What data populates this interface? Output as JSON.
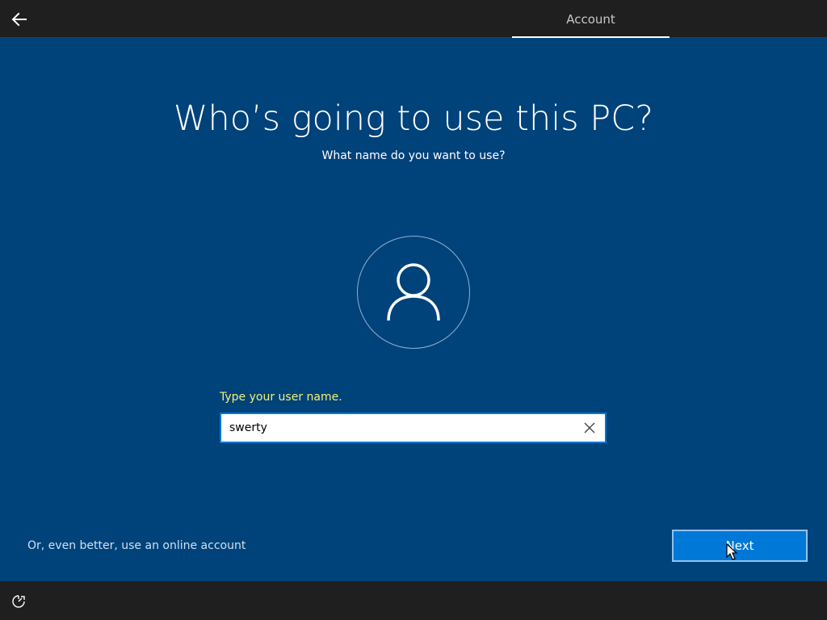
{
  "header": {
    "back_icon": "back-arrow-icon",
    "tab_label": "Account"
  },
  "main": {
    "title": "Who’s going to use this PC?",
    "subtitle": "What name do you want to use?",
    "avatar_icon": "person-icon"
  },
  "username": {
    "label": "Type your user name.",
    "value": "swerty",
    "clear_icon": "clear-x-icon"
  },
  "footer": {
    "online_account_link": "Or, even better, use an online account",
    "next_label": "Next"
  },
  "bottom_bar": {
    "ease_of_access_icon": "ease-of-access-icon"
  },
  "colors": {
    "background": "#00427a",
    "accent": "#0078d7",
    "label_yellow": "#f2f274",
    "bar_dark": "#1f1f1f"
  }
}
